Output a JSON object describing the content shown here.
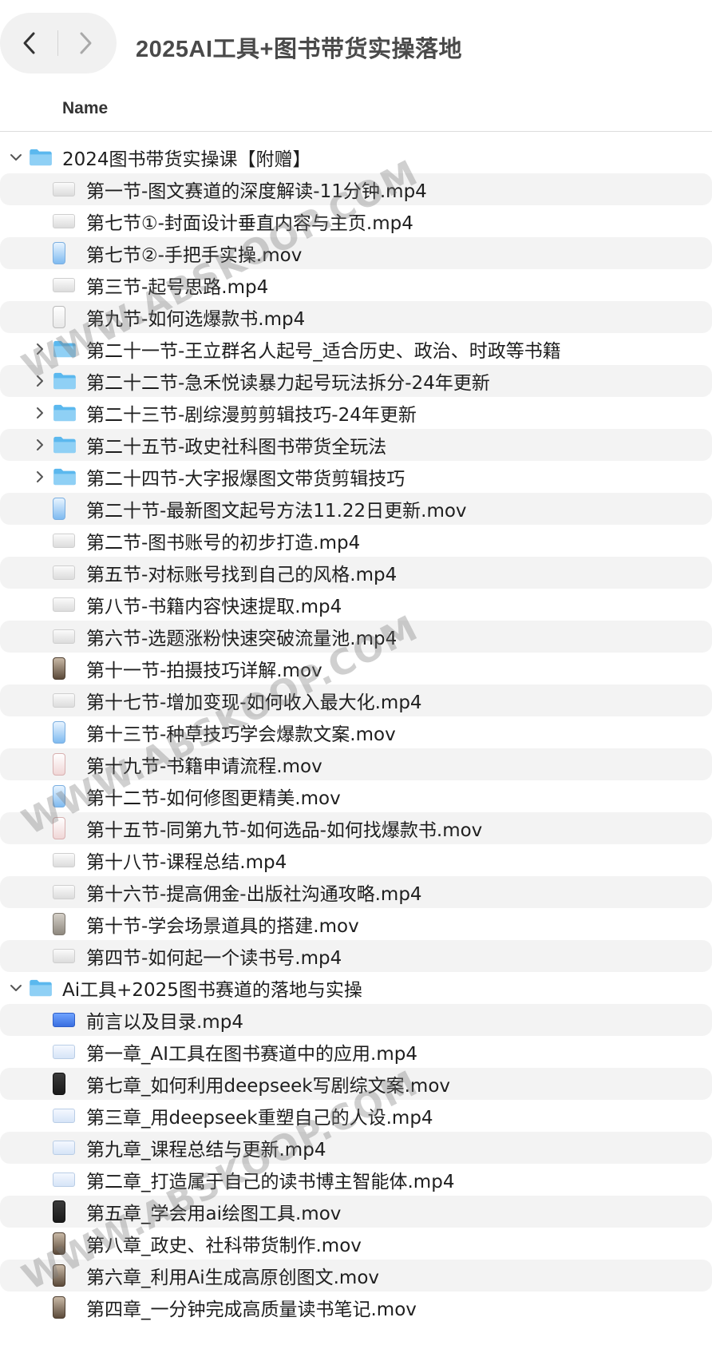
{
  "window": {
    "title": "2025AI工具+图书带货实操落地"
  },
  "toolbar": {
    "back_icon": "chevron-left-icon",
    "forward_icon": "chevron-right-icon"
  },
  "columns": {
    "name": "Name"
  },
  "colors": {
    "folder": "#5bb8ee",
    "folder_tab": "#8fd0f5",
    "stripe": "#f3f3f3"
  },
  "watermark": {
    "text": "WWW.ABSKOOP.COM"
  },
  "rows": [
    {
      "label": "2024图书带货实操课【附赠】",
      "kind": "folder",
      "level": 0,
      "expanded": true
    },
    {
      "label": "第一节-图文赛道的深度解读-11分钟.mp4",
      "kind": "video-land",
      "level": 1
    },
    {
      "label": "第七节①-封面设计垂直内容与主页.mp4",
      "kind": "video-land",
      "level": 1
    },
    {
      "label": "第七节②-手把手实操.mov",
      "kind": "port-blue",
      "level": 1
    },
    {
      "label": "第三节-起号思路.mp4",
      "kind": "video-land",
      "level": 1
    },
    {
      "label": "第九节-如何选爆款书.mp4",
      "kind": "port-white",
      "level": 1
    },
    {
      "label": "第二十一节-王立群名人起号_适合历史、政治、时政等书籍",
      "kind": "folder",
      "level": 1,
      "expanded": false
    },
    {
      "label": "第二十二节-急禾悦读暴力起号玩法拆分-24年更新",
      "kind": "folder",
      "level": 1,
      "expanded": false
    },
    {
      "label": "第二十三节-剧综漫剪剪辑技巧-24年更新",
      "kind": "folder",
      "level": 1,
      "expanded": false
    },
    {
      "label": "第二十五节-政史社科图书带货全玩法",
      "kind": "folder",
      "level": 1,
      "expanded": false
    },
    {
      "label": "第二十四节-大字报爆图文带货剪辑技巧",
      "kind": "folder",
      "level": 1,
      "expanded": false
    },
    {
      "label": "第二十节-最新图文起号方法11.22日更新.mov",
      "kind": "port-blue",
      "level": 1
    },
    {
      "label": "第二节-图书账号的初步打造.mp4",
      "kind": "video-land",
      "level": 1
    },
    {
      "label": "第五节-对标账号找到自己的风格.mp4",
      "kind": "video-land",
      "level": 1
    },
    {
      "label": "第八节-书籍内容快速提取.mp4",
      "kind": "video-land",
      "level": 1
    },
    {
      "label": "第六节-选题涨粉快速突破流量池.mp4",
      "kind": "video-land",
      "level": 1
    },
    {
      "label": "第十一节-拍摄技巧详解.mov",
      "kind": "port-brown",
      "level": 1
    },
    {
      "label": "第十七节-增加变现-如何收入最大化.mp4",
      "kind": "video-land",
      "level": 1
    },
    {
      "label": "第十三节-种草技巧学会爆款文案.mov",
      "kind": "port-blue",
      "level": 1
    },
    {
      "label": "第十九节-书籍申请流程.mov",
      "kind": "port-red",
      "level": 1
    },
    {
      "label": "第十二节-如何修图更精美.mov",
      "kind": "port-blue",
      "level": 1
    },
    {
      "label": "第十五节-同第九节-如何选品-如何找爆款书.mov",
      "kind": "port-red",
      "level": 1
    },
    {
      "label": "第十八节-课程总结.mp4",
      "kind": "video-land",
      "level": 1
    },
    {
      "label": "第十六节-提高佣金-出版社沟通攻略.mp4",
      "kind": "video-land",
      "level": 1
    },
    {
      "label": "第十节-学会场景道具的搭建.mov",
      "kind": "port-gray",
      "level": 1
    },
    {
      "label": "第四节-如何起一个读书号.mp4",
      "kind": "video-land",
      "level": 1
    },
    {
      "label": "Ai工具+2025图书赛道的落地与实操",
      "kind": "folder",
      "level": 0,
      "expanded": true
    },
    {
      "label": "前言以及目录.mp4",
      "kind": "video-pill",
      "level": 1
    },
    {
      "label": "第一章_AI工具在图书赛道中的应用.mp4",
      "kind": "video-blue",
      "level": 1
    },
    {
      "label": "第七章_如何利用deepseek写剧综文案.mov",
      "kind": "port-dark",
      "level": 1
    },
    {
      "label": "第三章_用deepseek重塑自己的人设.mp4",
      "kind": "video-blue",
      "level": 1
    },
    {
      "label": "第九章_课程总结与更新.mp4",
      "kind": "video-blue",
      "level": 1
    },
    {
      "label": "第二章_打造属于自己的读书博主智能体.mp4",
      "kind": "video-blue",
      "level": 1
    },
    {
      "label": "第五章_学会用ai绘图工具.mov",
      "kind": "port-dark",
      "level": 1
    },
    {
      "label": "第八章_政史、社科带货制作.mov",
      "kind": "port-brown",
      "level": 1
    },
    {
      "label": "第六章_利用Ai生成高原创图文.mov",
      "kind": "port-brown",
      "level": 1
    },
    {
      "label": "第四章_一分钟完成高质量读书笔记.mov",
      "kind": "port-brown",
      "level": 1
    }
  ]
}
